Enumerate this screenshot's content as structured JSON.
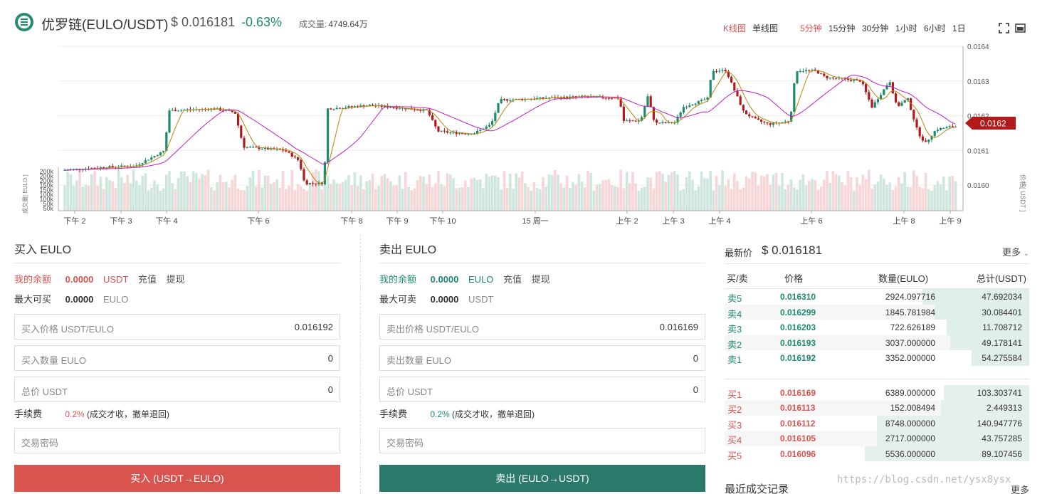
{
  "header": {
    "pair": "优罗链(EULO/USDT)",
    "price": "$ 0.016181",
    "change": "-0.63%",
    "volume_label": "成交量:",
    "volume_value": "4749.64万",
    "chart_types": [
      "K线图",
      "单线图"
    ],
    "intervals": [
      "5分钟",
      "15分钟",
      "30分钟",
      "1小时",
      "6小时",
      "1日"
    ],
    "active_interval": "5分钟",
    "icons": [
      "fullscreen-icon",
      "screenshot-icon"
    ]
  },
  "chart": {
    "price_axis": [
      "0.0164",
      "0.0163",
      "0.0162",
      "0.0161",
      "0.0160"
    ],
    "price_axis_title": "价格[ USDT ]",
    "volume_axis": [
      "200k",
      "200k",
      "200k",
      "150k",
      "150k",
      "100k",
      "100k",
      "50k",
      "50k"
    ],
    "volume_axis_title": "成交量[ EULO ]",
    "time_axis": [
      "下午 2",
      "下午 3",
      "下午 4",
      "下午 6",
      "下午 8",
      "下午 9",
      "下午 10",
      "15 周一",
      "上午 2",
      "上午 3",
      "上午 4",
      "上午 6",
      "上午 8",
      "上午 9"
    ],
    "last_price_tag": "0.0162",
    "colors": {
      "up": "#1e8a6e",
      "down": "#b01a1a",
      "ma_fast": "#b8860b",
      "ma_slow": "#c020c0"
    }
  },
  "buy": {
    "title": "买入 EULO",
    "balance_label": "我的余额",
    "balance_value": "0.0000",
    "balance_unit": "USDT",
    "deposit": "充值",
    "withdraw": "提现",
    "max_label": "最大可买",
    "max_value": "0.0000",
    "max_unit": "EULO",
    "price_placeholder": "买入价格 USDT/EULO",
    "price_value": "0.016192",
    "amount_placeholder": "买入数量 EULO",
    "amount_value": "0",
    "total_placeholder": "总价 USDT",
    "total_value": "0",
    "fee_label": "手续费",
    "fee_rate": "0.2%",
    "fee_note": "(成交才收，撤单退回)",
    "password_placeholder": "交易密码",
    "button": "买入 (USDT→EULO)"
  },
  "sell": {
    "title": "卖出 EULO",
    "balance_label": "我的余额",
    "balance_value": "0.0000",
    "balance_unit": "EULO",
    "deposit": "充值",
    "withdraw": "提现",
    "max_label": "最大可卖",
    "max_value": "0.0000",
    "max_unit": "USDT",
    "price_placeholder": "卖出价格 USDT/EULO",
    "price_value": "0.016169",
    "amount_placeholder": "卖出数量 EULO",
    "amount_value": "0",
    "total_placeholder": "总价 USDT",
    "total_value": "0",
    "fee_label": "手续费",
    "fee_rate": "0.2%",
    "fee_note": "(成交才收，撤单退回)",
    "password_placeholder": "交易密码",
    "button": "卖出 (EULO→USDT)"
  },
  "orderbook": {
    "latest_label": "最新价",
    "latest_price": "$ 0.016181",
    "more": "更多",
    "columns": [
      "买/卖",
      "价格",
      "数量(EULO)",
      "总计(USDT)"
    ],
    "asks": [
      {
        "side": "卖5",
        "price": "0.016310",
        "amount": "2924.097716",
        "total": "47.692034",
        "depth": 0.35
      },
      {
        "side": "卖4",
        "price": "0.016299",
        "amount": "1845.781984",
        "total": "30.084401",
        "depth": 0.31
      },
      {
        "side": "卖3",
        "price": "0.016203",
        "amount": "722.626189",
        "total": "11.708712",
        "depth": 0.27
      },
      {
        "side": "卖2",
        "price": "0.016193",
        "amount": "3037.000000",
        "total": "49.178141",
        "depth": 0.26
      },
      {
        "side": "卖1",
        "price": "0.016192",
        "amount": "3352.000000",
        "total": "54.275584",
        "depth": 0.19
      }
    ],
    "bids": [
      {
        "side": "买1",
        "price": "0.016169",
        "amount": "6389.000000",
        "total": "103.303741",
        "depth": 0.28
      },
      {
        "side": "买2",
        "price": "0.016113",
        "amount": "152.008494",
        "total": "2.449313",
        "depth": 0.29
      },
      {
        "side": "买3",
        "price": "0.016112",
        "amount": "8748.000000",
        "total": "140.947776",
        "depth": 0.5
      },
      {
        "side": "买4",
        "price": "0.016105",
        "amount": "2717.000000",
        "total": "43.757285",
        "depth": 0.5
      },
      {
        "side": "买5",
        "price": "0.016096",
        "amount": "5536.000000",
        "total": "89.107456",
        "depth": 0.54
      }
    ]
  },
  "recent": {
    "title": "最近成交记录",
    "more": "更多"
  },
  "watermark": "https://blog.csdn.net/ysx8ysx"
}
